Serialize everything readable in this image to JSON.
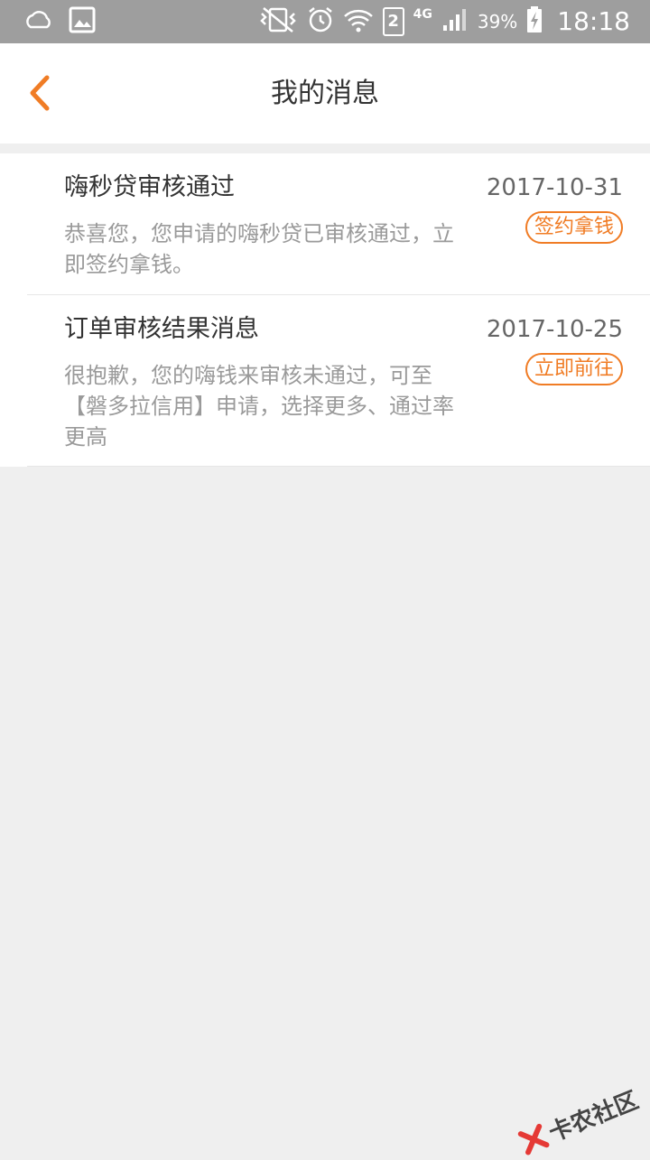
{
  "status_bar": {
    "battery": "39%",
    "time": "18:18",
    "sim": "2",
    "network": "4G",
    "icons": [
      "weather-icon",
      "gallery-icon",
      "vibrate-icon",
      "alarm-icon",
      "wifi-icon",
      "signal-icon",
      "battery-icon"
    ]
  },
  "header": {
    "title": "我的消息",
    "accent_color": "#f07c25"
  },
  "messages": [
    {
      "title": "嗨秒贷审核通过",
      "date": "2017-10-31",
      "body": "恭喜您，您申请的嗨秒贷已审核通过，立即签约拿钱。",
      "action": "签约拿钱"
    },
    {
      "title": "订单审核结果消息",
      "date": "2017-10-25",
      "body": "很抱歉，您的嗨钱来审核未通过，可至【磐多拉信用】申请，选择更多、通过率更高",
      "action": "立即前往"
    }
  ],
  "watermark": {
    "text": "卡农社区"
  }
}
